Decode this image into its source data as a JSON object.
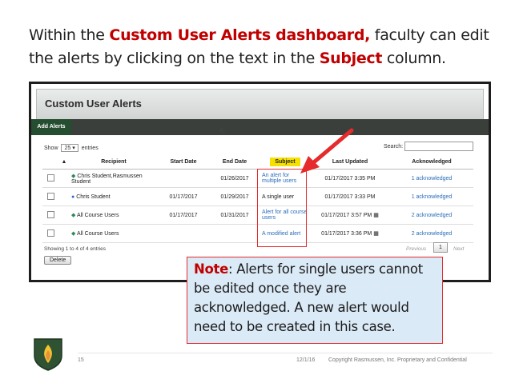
{
  "intro": {
    "part1": "Within the ",
    "highlight1": "Custom User Alerts dashboard,",
    "part2": " faculty can edit the alerts by clicking on the text in the ",
    "highlight2": "Subject",
    "part3": " column."
  },
  "screenshot": {
    "title": "Custom User Alerts",
    "add_button": "Add Alerts",
    "show_label": "Show",
    "show_value": "25",
    "entries_label": "entries",
    "search_label": "Search:",
    "columns": [
      "",
      "▲",
      "Recipient",
      "Start Date",
      "End Date",
      "Subject",
      "Last Updated",
      "Acknowledged"
    ],
    "rows": [
      {
        "recipient": "Chris Student,Rasmussen Student",
        "icon": "leaf",
        "start": "",
        "end": "01/26/2017",
        "subject": "An alert for multiple users",
        "subject_link": true,
        "updated": "01/17/2017 3:35 PM",
        "ack": "1 acknowledged"
      },
      {
        "recipient": "Chris Student",
        "icon": "person",
        "start": "01/17/2017",
        "end": "01/29/2017",
        "subject": "A single user",
        "subject_link": false,
        "updated": "01/17/2017 3:33 PM",
        "ack": "1 acknowledged"
      },
      {
        "recipient": "All Course Users",
        "icon": "leaf",
        "start": "01/17/2017",
        "end": "01/31/2017",
        "subject": "Alert for all course users",
        "subject_link": true,
        "updated": "01/17/2017 3:57 PM",
        "ack": "2 acknowledged"
      },
      {
        "recipient": "All Course Users",
        "icon": "leaf",
        "start": "",
        "end": "",
        "subject": "A modified alert",
        "subject_link": true,
        "updated": "01/17/2017 3:36 PM",
        "ack": "2 acknowledged"
      }
    ],
    "showing_text": "Showing 1 to 4 of 4 entries",
    "delete_label": "Delete",
    "prev_label": "Previous",
    "page_label": "1",
    "next_label": "Next"
  },
  "note": {
    "label": "Note",
    "text": ": Alerts for single users cannot be edited once they are acknowledged. A new alert would need to be created in this case."
  },
  "footer": {
    "page": "15",
    "date": "12/1/16",
    "copyright": "Copyright Rasmussen, Inc. Proprietary and Confidential"
  },
  "colors": {
    "highlight": "#c00000",
    "note_bg": "#dbeaf7",
    "callout_border": "#e52b2b",
    "subject_highlight": "#f6e000"
  }
}
